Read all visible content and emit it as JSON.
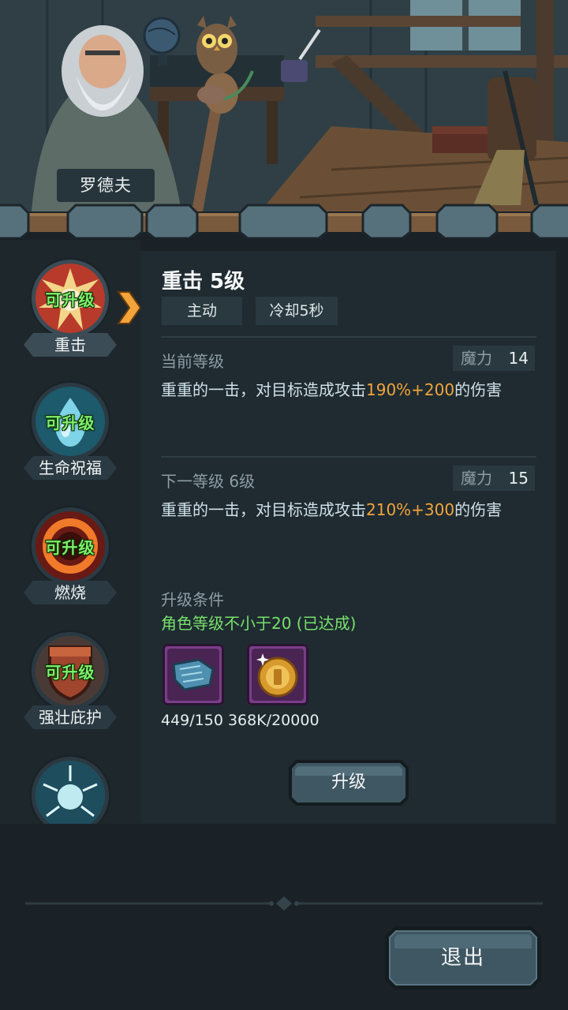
{
  "npc": {
    "name": "罗德夫"
  },
  "skills": [
    {
      "name": "重击",
      "badge": "可升级",
      "icon": "strike-burst-icon",
      "selected": true
    },
    {
      "name": "生命祝福",
      "badge": "可升级",
      "icon": "water-drop-icon"
    },
    {
      "name": "燃烧",
      "badge": "可升级",
      "icon": "fire-ring-icon"
    },
    {
      "name": "强壮庇护",
      "badge": "可升级",
      "icon": "shield-icon"
    },
    {
      "name": "",
      "badge": "",
      "icon": "lightning-orb-icon"
    }
  ],
  "detail": {
    "title": "重击 5级",
    "tags": [
      "主动",
      "冷却5秒"
    ],
    "current": {
      "label": "当前等级",
      "mana_label": "魔力",
      "mana_value": "14",
      "desc_prefix": "重重的一击，对目标造成攻击",
      "desc_highlight": "190%+200",
      "desc_suffix": "的伤害"
    },
    "next": {
      "label": "下一等级 6级",
      "mana_label": "魔力",
      "mana_value": "15",
      "desc_prefix": "重重的一击，对目标造成攻击",
      "desc_highlight": "210%+300",
      "desc_suffix": "的伤害"
    },
    "condition_label": "升级条件",
    "condition_text": "角色等级不小于20 (已达成)",
    "materials": [
      {
        "icon": "scroll-map-icon"
      },
      {
        "icon": "gold-coin-icon"
      }
    ],
    "material_counts": "449/150 368K/20000",
    "upgrade_label": "升级"
  },
  "exit_label": "退出",
  "colors": {
    "highlight": "#f2a43a",
    "condition_ok": "#78e06c",
    "badge_green": "#7ef06a",
    "panel_bg": "#1f2b31"
  }
}
